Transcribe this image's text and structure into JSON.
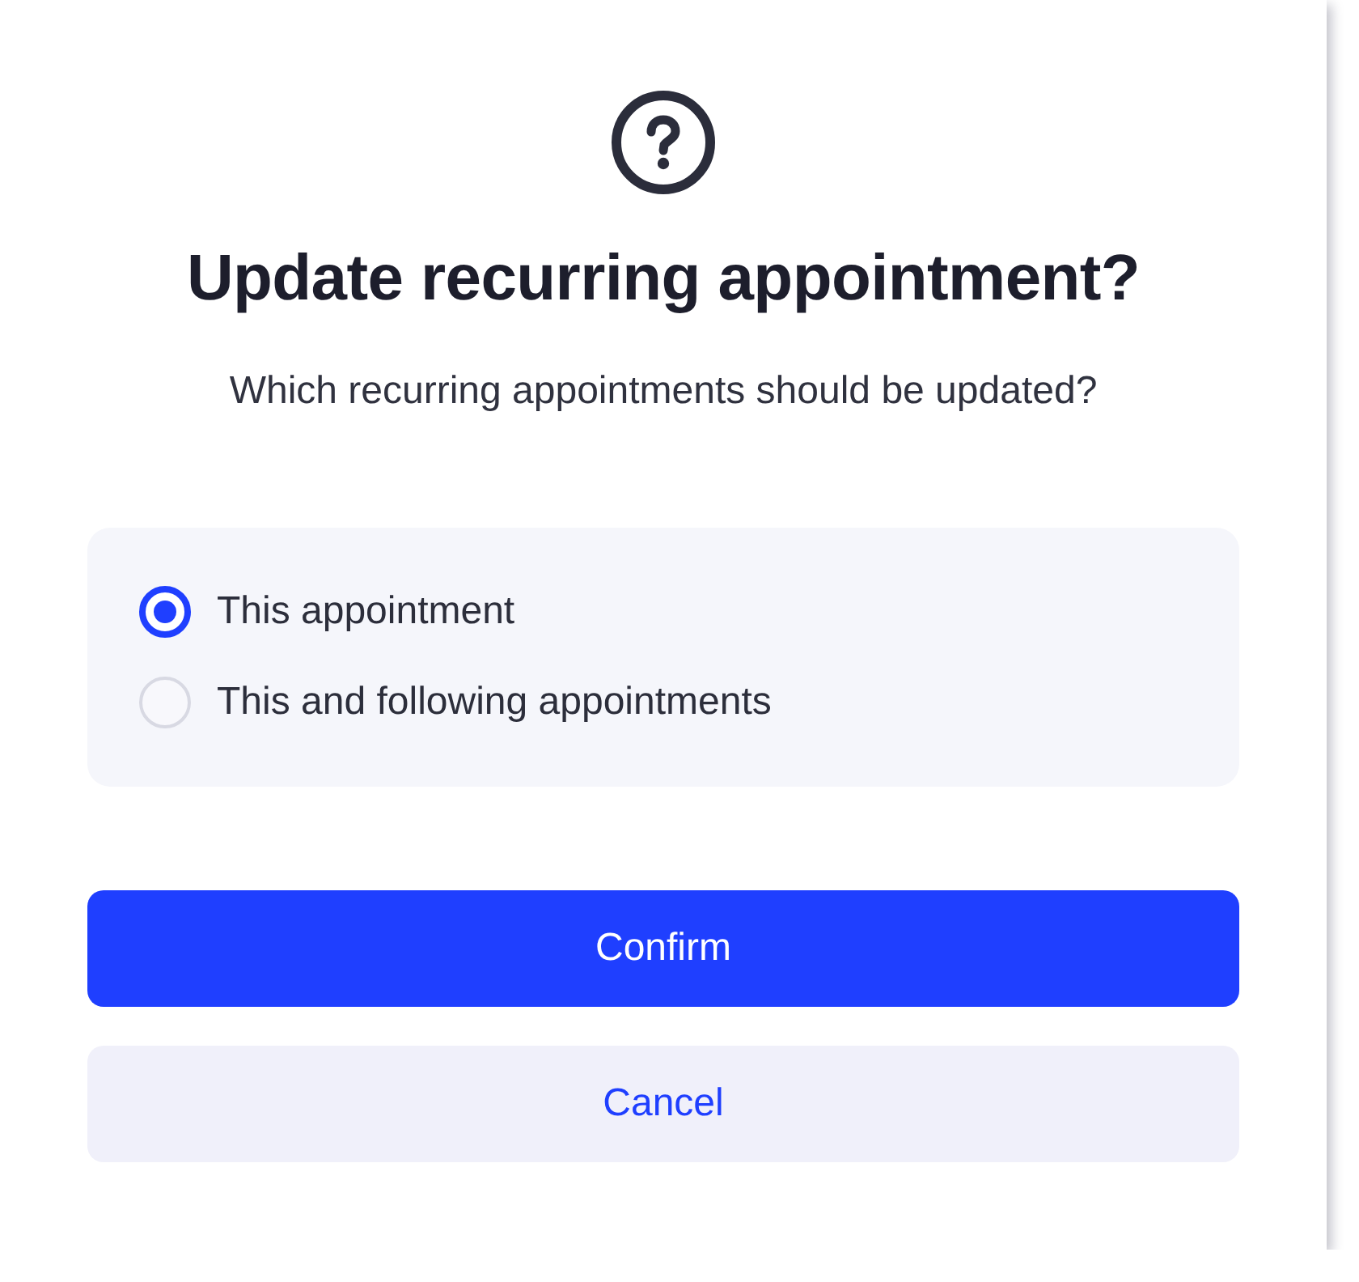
{
  "dialog": {
    "title": "Update recurring appointment?",
    "message": "Which recurring appointments should be updated?",
    "options": [
      {
        "label": "This appointment",
        "selected": true
      },
      {
        "label": "This and following appointments",
        "selected": false
      }
    ],
    "buttons": [
      {
        "label": "Confirm",
        "kind": "primary"
      },
      {
        "label": "Cancel",
        "kind": "secondary"
      }
    ]
  }
}
